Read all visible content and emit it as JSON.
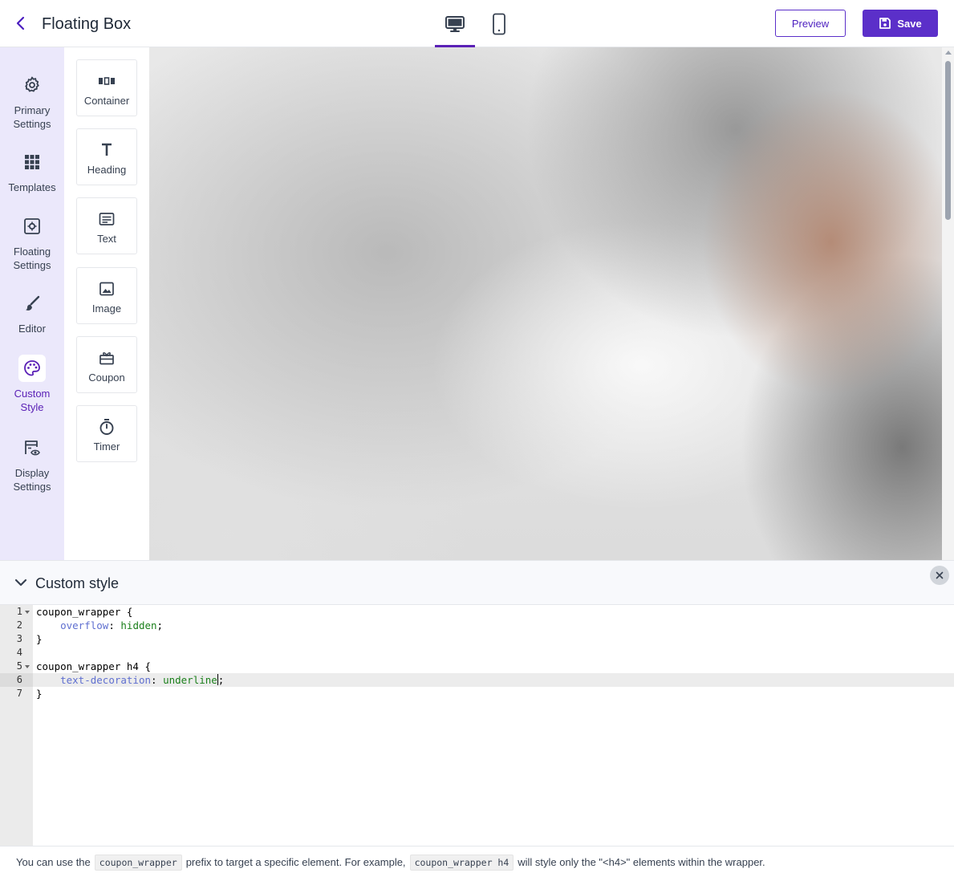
{
  "header": {
    "title": "Floating Box",
    "preview_label": "Preview",
    "save_label": "Save",
    "devices": [
      "desktop",
      "mobile"
    ],
    "active_device": "desktop"
  },
  "sidebar": {
    "items": [
      {
        "label": "Primary Settings",
        "icon": "gear-icon"
      },
      {
        "label": "Templates",
        "icon": "grid-icon"
      },
      {
        "label": "Floating Settings",
        "icon": "settings-box-icon"
      },
      {
        "label": "Editor",
        "icon": "brush-icon"
      },
      {
        "label": "Custom Style",
        "icon": "palette-icon",
        "active": true
      },
      {
        "label": "Display Settings",
        "icon": "display-eye-icon"
      }
    ]
  },
  "elements": {
    "items": [
      {
        "label": "Container",
        "icon": "columns-icon"
      },
      {
        "label": "Heading",
        "icon": "heading-icon"
      },
      {
        "label": "Text",
        "icon": "text-icon"
      },
      {
        "label": "Image",
        "icon": "image-icon"
      },
      {
        "label": "Coupon",
        "icon": "gift-icon"
      },
      {
        "label": "Timer",
        "icon": "stopwatch-icon"
      }
    ]
  },
  "custom_style": {
    "title": "Custom style",
    "active_line": 6,
    "lines": [
      {
        "num": "1",
        "fold": true,
        "selector": "coupon_wrapper {"
      },
      {
        "num": "2",
        "prop": "overflow",
        "value": "hidden"
      },
      {
        "num": "3",
        "selector": "}"
      },
      {
        "num": "4",
        "selector": ""
      },
      {
        "num": "5",
        "fold": true,
        "selector": "coupon_wrapper h4 {"
      },
      {
        "num": "6",
        "prop": "text-decoration",
        "value": "underline"
      },
      {
        "num": "7",
        "selector": "}"
      }
    ],
    "note": {
      "part1": "You can use the",
      "code1": "coupon_wrapper",
      "part2": "prefix to target a specific element. For example,",
      "code2": "coupon_wrapper h4",
      "part3": "will style only the \"<h4>\" elements within the wrapper."
    }
  },
  "colors": {
    "accent": "#5b2fc9",
    "sidebar_bg": "#ebe8fb",
    "active_text": "#5b21b6"
  }
}
